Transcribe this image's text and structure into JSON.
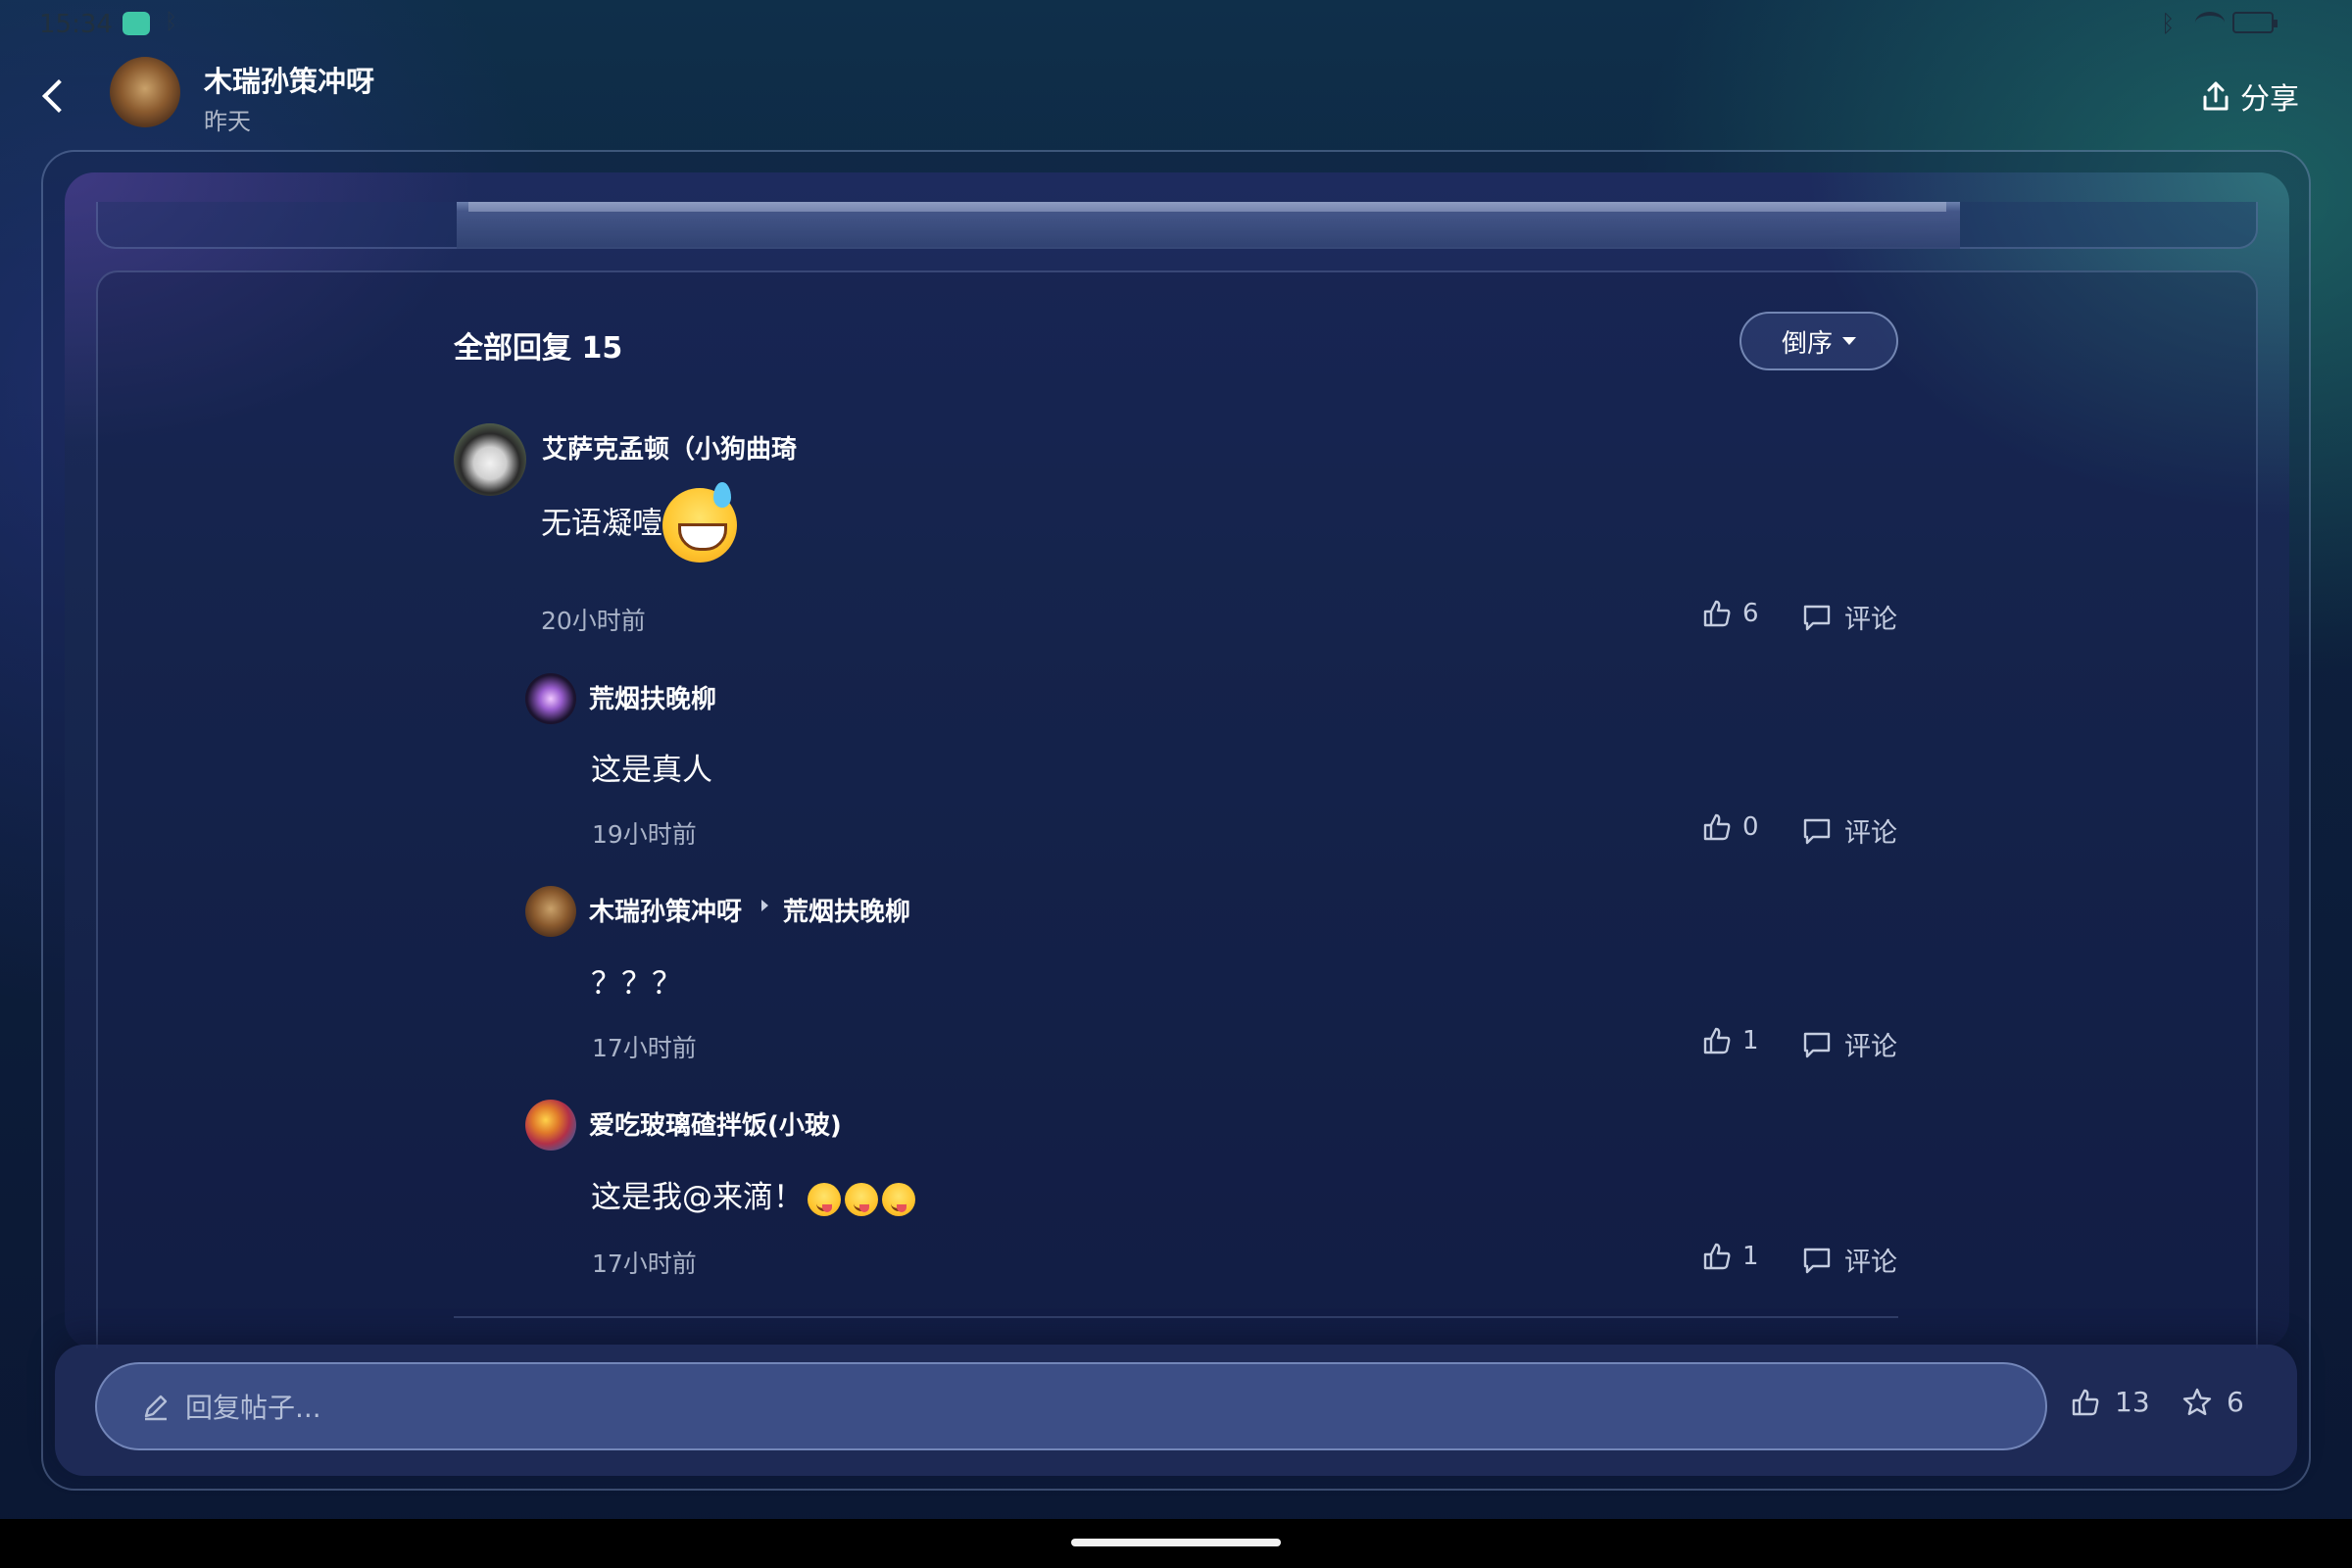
{
  "status_bar": {
    "time": "15:34",
    "bluetooth_icon": "bluetooth-icon",
    "wifi_icon": "wifi-icon",
    "battery_icon": "battery-icon"
  },
  "header": {
    "author_name": "木瑞孙策冲呀",
    "post_date": "昨天",
    "share_label": "分享"
  },
  "replies": {
    "title": "全部回复 15",
    "sort_label": "倒序",
    "items": [
      {
        "author": "艾萨克孟顿（小狗曲琦",
        "text": "无语凝噎",
        "time": "20小时前",
        "likes": "6",
        "comment_label": "评论"
      },
      {
        "author": "荒烟扶晚柳",
        "text": "这是真人",
        "time": "19小时前",
        "likes": "0",
        "comment_label": "评论"
      },
      {
        "author": "木瑞孙策冲呀",
        "reply_to": "荒烟扶晚柳",
        "text": "？？？",
        "time": "17小时前",
        "likes": "1",
        "comment_label": "评论"
      },
      {
        "author": "爱吃玻璃碴拌饭(小玻)",
        "text": "这是我@来滴！",
        "time": "17小时前",
        "likes": "1",
        "comment_label": "评论"
      }
    ]
  },
  "bottom_bar": {
    "reply_placeholder": "回复帖子...",
    "like_count": "13",
    "star_count": "6"
  },
  "colors": {
    "accent": "#3c4e86",
    "text_primary": "#ffffff",
    "text_secondary": "#a9b3c8"
  }
}
